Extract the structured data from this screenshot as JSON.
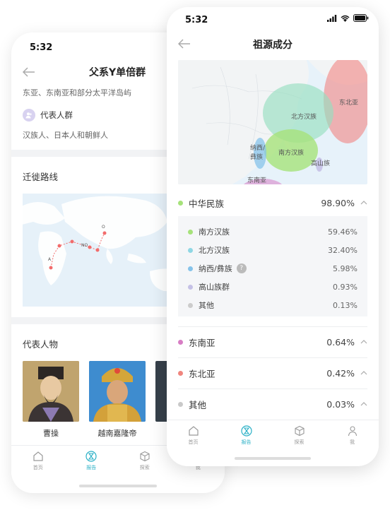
{
  "back_screen": {
    "status_time": "5:32",
    "title": "父系Y单倍群",
    "regions": "东亚、东南亚和部分太平洋岛屿",
    "rep_label": "代表人群",
    "rep_populations": "汉族人、日本人和朝鲜人",
    "migration_title": "迁徙路线",
    "migration_markers": [
      "A",
      "NO",
      "O"
    ],
    "figures_title": "代表人物",
    "figures": [
      {
        "name": "曹操"
      },
      {
        "name": "越南嘉隆帝"
      }
    ]
  },
  "front_screen": {
    "status_time": "5:32",
    "title": "祖源成分",
    "map_labels": {
      "northeast": "东北亚",
      "north_han": "北方汉族",
      "south_han": "南方汉族",
      "naxi": "纳西/\n彝族",
      "gaoshan": "高山族",
      "southeast": "东南亚"
    },
    "groups": [
      {
        "name": "中华民族",
        "percent": "98.90%",
        "color": "#a6e27a"
      },
      {
        "name": "东南亚",
        "percent": "0.64%",
        "color": "#d77dc4"
      },
      {
        "name": "东北亚",
        "percent": "0.42%",
        "color": "#f0857e"
      },
      {
        "name": "其他",
        "percent": "0.03%",
        "color": "#c9c9c9"
      }
    ],
    "subgroups": [
      {
        "name": "南方汉族",
        "percent": "59.46%",
        "color": "#a6e27a"
      },
      {
        "name": "北方汉族",
        "percent": "32.40%",
        "color": "#8fd7e4"
      },
      {
        "name": "纳西/彝族",
        "percent": "5.98%",
        "color": "#86c3ea",
        "help": "?"
      },
      {
        "name": "高山族群",
        "percent": "0.93%",
        "color": "#c5c1e6"
      },
      {
        "name": "其他",
        "percent": "0.13%",
        "color": "#cccccc"
      }
    ]
  },
  "tabs": [
    {
      "label": "首页",
      "icon": "home-icon"
    },
    {
      "label": "报告",
      "icon": "hourglass-icon"
    },
    {
      "label": "探索",
      "icon": "cube-icon"
    },
    {
      "label": "我",
      "icon": "person-icon"
    }
  ],
  "colors": {
    "accent": "#2ab0c6",
    "map_water": "#e7f2fa"
  }
}
